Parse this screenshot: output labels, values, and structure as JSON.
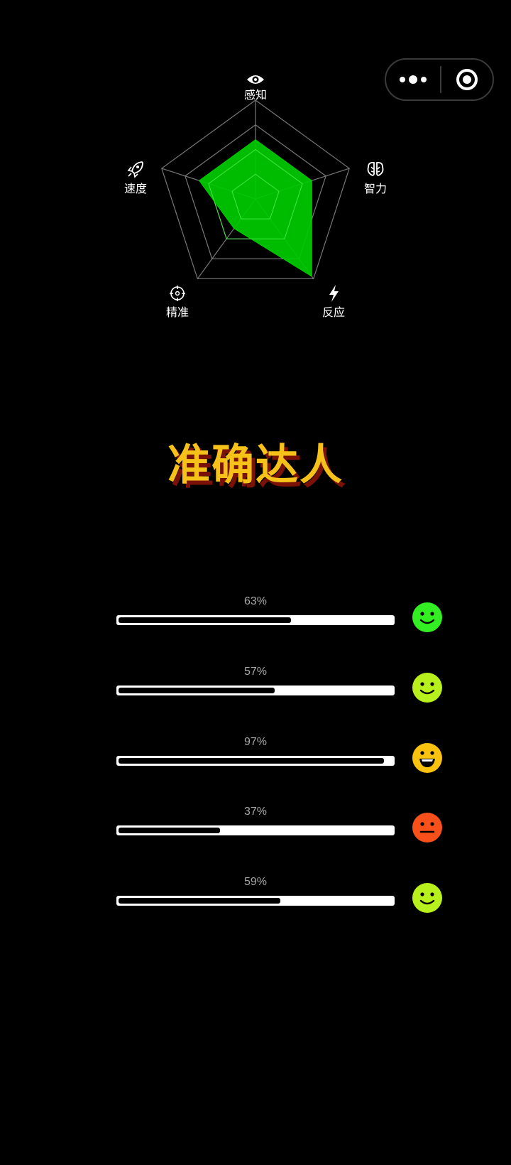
{
  "radar": {
    "axes": [
      {
        "label": "感知",
        "icon": "eye-icon",
        "value": 0.6
      },
      {
        "label": "智力",
        "icon": "brain-icon",
        "value": 0.6
      },
      {
        "label": "反应",
        "icon": "lightning-icon",
        "value": 0.97
      },
      {
        "label": "精准",
        "icon": "crosshair-icon",
        "value": 0.37
      },
      {
        "label": "速度",
        "icon": "rocket-icon",
        "value": 0.6
      }
    ],
    "fill_color": "#00cc00",
    "grid_color": "#777777"
  },
  "title": "准确达人",
  "bars": [
    {
      "percent_text": "63%",
      "value": 0.63,
      "face": "smile",
      "face_color": "#33ee22"
    },
    {
      "percent_text": "57%",
      "value": 0.57,
      "face": "smile",
      "face_color": "#b8f01e"
    },
    {
      "percent_text": "97%",
      "value": 0.97,
      "face": "grin",
      "face_color": "#f8c20e"
    },
    {
      "percent_text": "37%",
      "value": 0.37,
      "face": "neutral",
      "face_color": "#f7501a"
    },
    {
      "percent_text": "59%",
      "value": 0.59,
      "face": "smile",
      "face_color": "#b8f01e"
    }
  ]
}
